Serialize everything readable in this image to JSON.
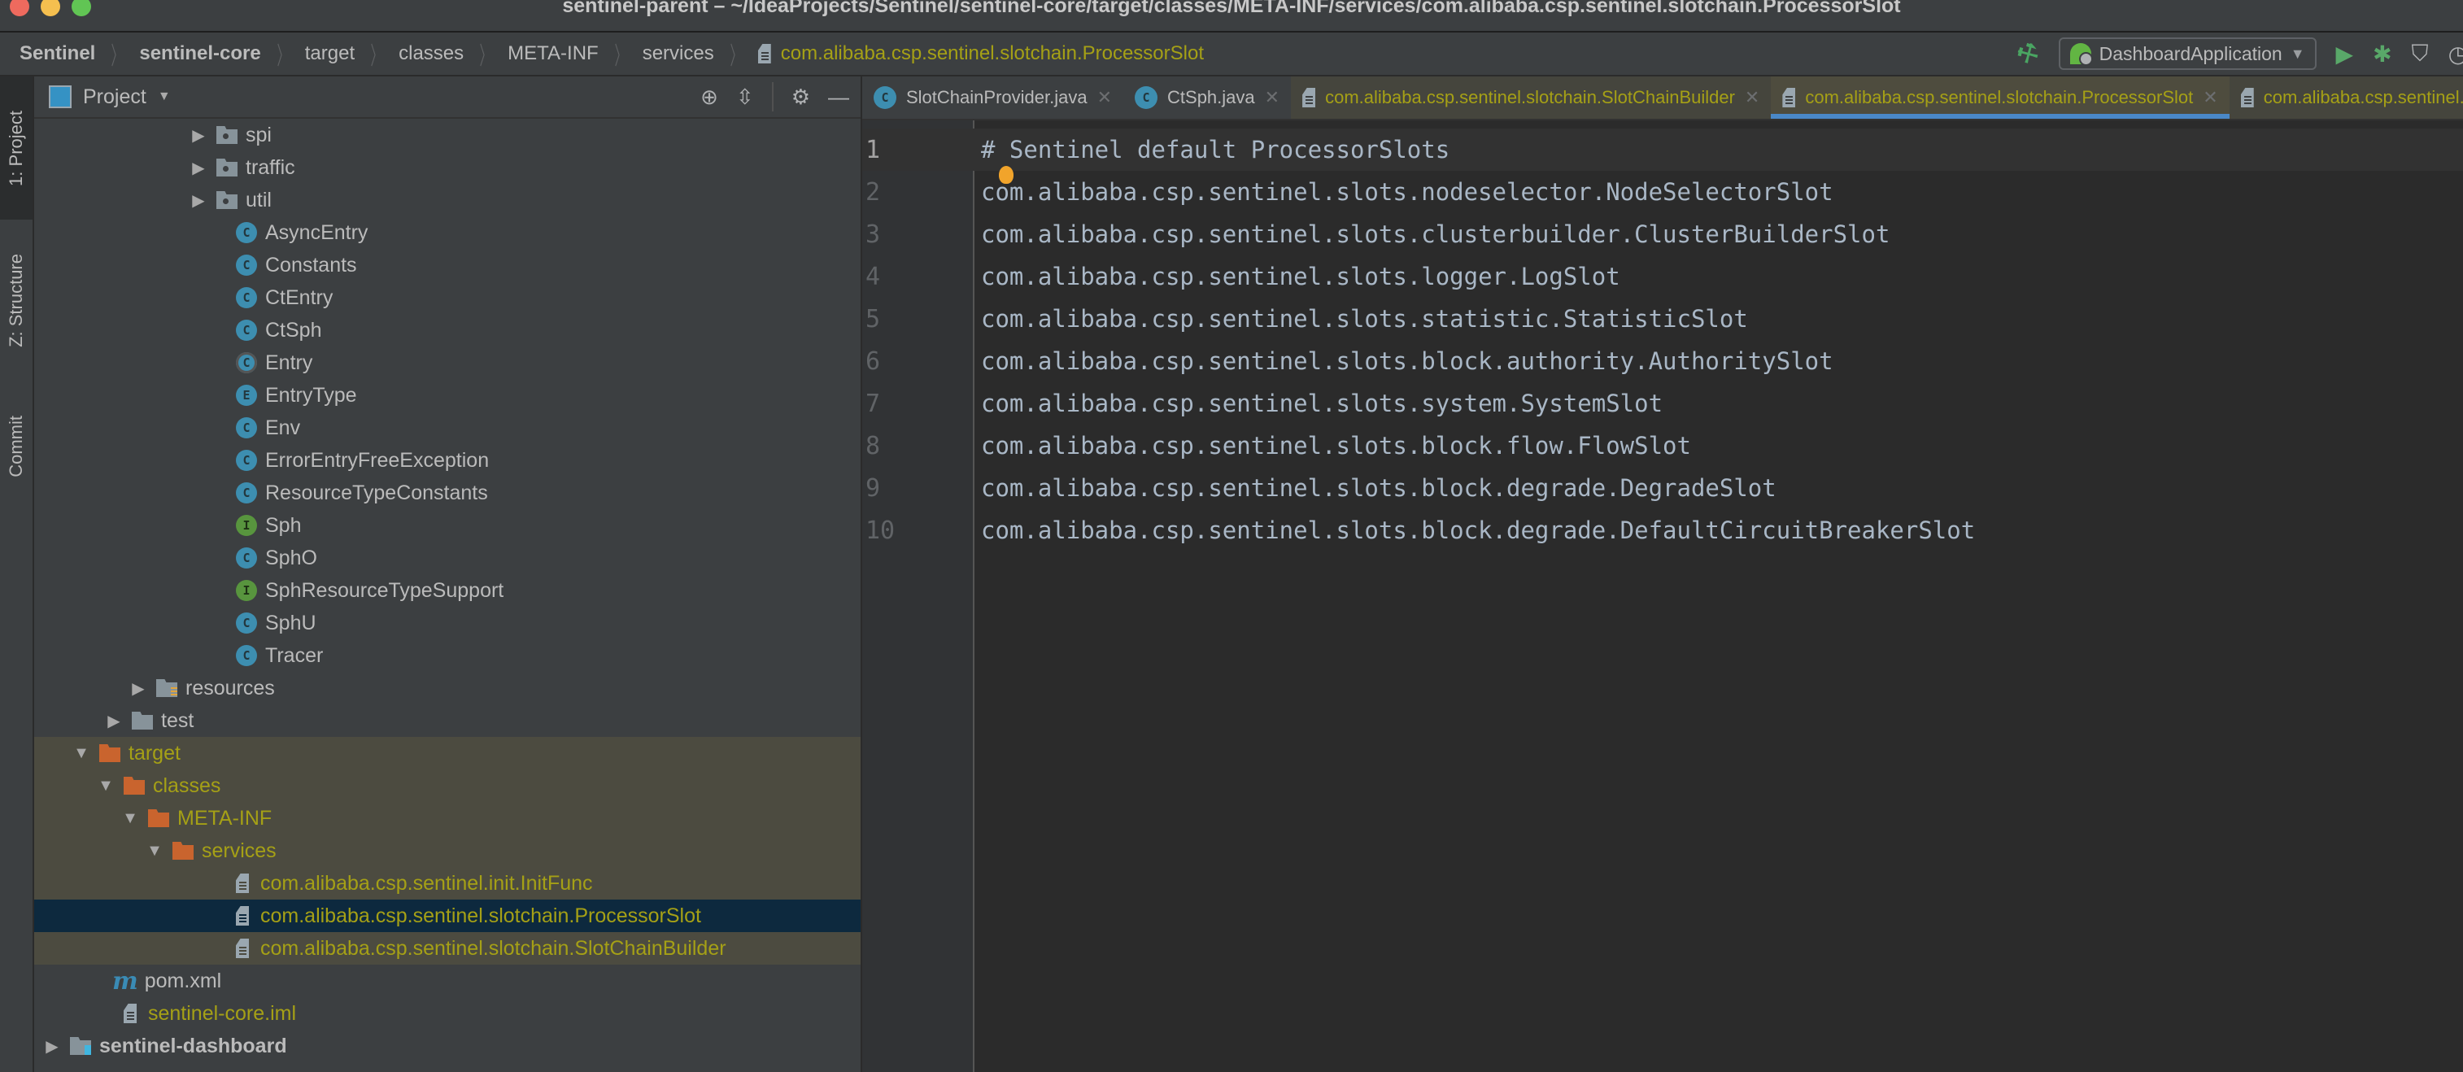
{
  "window": {
    "title": "sentinel-parent – ~/IdeaProjects/Sentinel/sentinel-core/target/classes/META-INF/services/com.alibaba.csp.sentinel.slotchain.ProcessorSlot"
  },
  "breadcrumb": {
    "items": [
      "Sentinel",
      "sentinel-core",
      "target",
      "classes",
      "META-INF",
      "services"
    ],
    "file": "com.alibaba.csp.sentinel.slotchain.ProcessorSlot"
  },
  "toolbar": {
    "build_icon": "hammer-icon",
    "run_config": "DashboardApplication",
    "run_icon": "play-icon",
    "debug_icon": "bug-icon",
    "coverage_icon": "shield-run-icon",
    "profile_icon": "clock-run-icon"
  },
  "stripe": {
    "project": "1: Project",
    "structure": "Z: Structure",
    "commit": "Commit"
  },
  "project_panel": {
    "title": "Project",
    "tree": [
      {
        "label": "spi",
        "type": "package",
        "arrow": "collapsed"
      },
      {
        "label": "traffic",
        "type": "package",
        "arrow": "collapsed"
      },
      {
        "label": "util",
        "type": "package",
        "arrow": "collapsed"
      },
      {
        "label": "AsyncEntry",
        "type": "class"
      },
      {
        "label": "Constants",
        "type": "class-static"
      },
      {
        "label": "CtEntry",
        "type": "class"
      },
      {
        "label": "CtSph",
        "type": "class"
      },
      {
        "label": "Entry",
        "type": "class-abstract"
      },
      {
        "label": "EntryType",
        "type": "enum"
      },
      {
        "label": "Env",
        "type": "class"
      },
      {
        "label": "ErrorEntryFreeException",
        "type": "class"
      },
      {
        "label": "ResourceTypeConstants",
        "type": "class-static"
      },
      {
        "label": "Sph",
        "type": "interface"
      },
      {
        "label": "SphO",
        "type": "class"
      },
      {
        "label": "SphResourceTypeSupport",
        "type": "interface"
      },
      {
        "label": "SphU",
        "type": "class"
      },
      {
        "label": "Tracer",
        "type": "class"
      },
      {
        "label": "resources",
        "type": "resources-folder",
        "arrow": "collapsed"
      },
      {
        "label": "test",
        "type": "folder",
        "arrow": "collapsed"
      },
      {
        "label": "target",
        "type": "excluded-folder",
        "arrow": "expanded"
      },
      {
        "label": "classes",
        "type": "excluded-folder",
        "arrow": "expanded"
      },
      {
        "label": "META-INF",
        "type": "excluded-folder",
        "arrow": "expanded"
      },
      {
        "label": "services",
        "type": "excluded-folder",
        "arrow": "expanded"
      },
      {
        "label": "com.alibaba.csp.sentinel.init.InitFunc",
        "type": "file"
      },
      {
        "label": "com.alibaba.csp.sentinel.slotchain.ProcessorSlot",
        "type": "file",
        "selected": true
      },
      {
        "label": "com.alibaba.csp.sentinel.slotchain.SlotChainBuilder",
        "type": "file"
      },
      {
        "label": "pom.xml",
        "type": "maven"
      },
      {
        "label": "sentinel-core.iml",
        "type": "iml"
      },
      {
        "label": "sentinel-dashboard",
        "type": "module",
        "arrow": "collapsed"
      }
    ]
  },
  "tabs": [
    {
      "label": "SlotChainProvider.java",
      "icon": "class-icon"
    },
    {
      "label": "CtSph.java",
      "icon": "class-icon"
    },
    {
      "label": "com.alibaba.csp.sentinel.slotchain.SlotChainBuilder",
      "icon": "file-icon"
    },
    {
      "label": "com.alibaba.csp.sentinel.slotchain.ProcessorSlot",
      "icon": "file-icon",
      "active": true
    },
    {
      "label": "com.alibaba.csp.sentinel.init.InitFunc",
      "icon": "file-icon"
    }
  ],
  "editor": {
    "lines": [
      "# Sentinel default ProcessorSlots",
      "com.alibaba.csp.sentinel.slots.nodeselector.NodeSelectorSlot",
      "com.alibaba.csp.sentinel.slots.clusterbuilder.ClusterBuilderSlot",
      "com.alibaba.csp.sentinel.slots.logger.LogSlot",
      "com.alibaba.csp.sentinel.slots.statistic.StatisticSlot",
      "com.alibaba.csp.sentinel.slots.block.authority.AuthoritySlot",
      "com.alibaba.csp.sentinel.slots.system.SystemSlot",
      "com.alibaba.csp.sentinel.slots.block.flow.FlowSlot",
      "com.alibaba.csp.sentinel.slots.block.degrade.DegradeSlot",
      "com.alibaba.csp.sentinel.slots.block.degrade.DefaultCircuitBreakerSlot"
    ],
    "line_numbers": [
      "1",
      "2",
      "3",
      "4",
      "5",
      "6",
      "7",
      "8",
      "9",
      "10"
    ]
  },
  "colors": {
    "accent_tab_underline": "#4a88c7",
    "excluded_text": "#a5a016",
    "selection": "#0d293e"
  }
}
